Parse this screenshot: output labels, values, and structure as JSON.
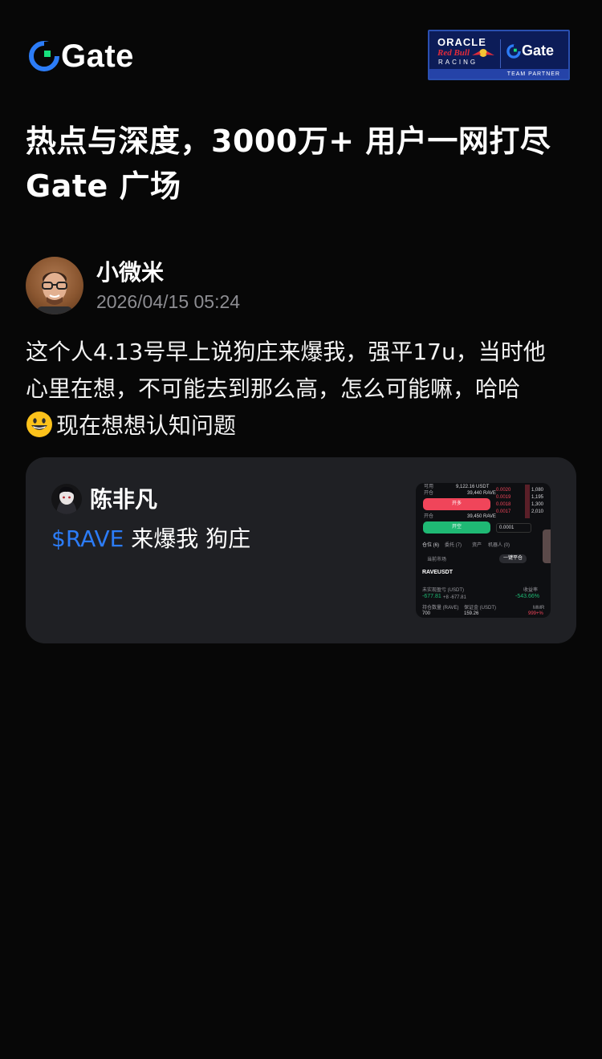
{
  "brand": {
    "name": "Gate",
    "accent": "#17e07d",
    "accent_blue": "#2c7cf7"
  },
  "partner_badge": {
    "oracle": "ORACLE",
    "redbull": "Red Bull",
    "racing": "RACING",
    "partner_brand": "Gate",
    "team_partner": "TEAM PARTNER"
  },
  "headline": {
    "line1": "热点与深度，3000万+ 用户一网打尽",
    "line2": "Gate 广场"
  },
  "post": {
    "author": "小微米",
    "timestamp": "2026/04/15 05:24",
    "body_line1": "这个人4.13号早上说狗庄来爆我，强平17u，当时他",
    "body_line2": "心里在想，不可能去到那么高，怎么可能嘛，哈哈",
    "body_line3": "现在想想认知问题",
    "emoji": "grinning-face"
  },
  "quote": {
    "author": "陈非凡",
    "ticker": "$RAVE",
    "text": " 来爆我 狗庄",
    "thumbnail": {
      "avail_label": "可用",
      "avail_value": "9,122.16 USDT",
      "open_label": "开仓",
      "open_value": "39,440 RAVE",
      "long_button": "开多",
      "open_label_2": "开仓",
      "open_value_2": "39,450 RAVE",
      "short_button": "开空",
      "order_price": "0.0001",
      "tab_positions": "仓位 (6)",
      "tab_orders": "委托 (7)",
      "tab_assets": "资产",
      "tab_bots": "机器人 (0)",
      "close_all": "一键平仓",
      "hide_other": "当前市场",
      "symbol": "RAVEUSDT",
      "pnl_label": "未实现盈亏 (USDT)",
      "pnl_value": "-677.81",
      "pnl_sub": "+8 -677.81",
      "roe_label": "收益率",
      "roe_value": "-543.66%",
      "size_label": "持仓数量 (RAVE)",
      "size_value": "700",
      "margin_label": "保证金 (USDT)",
      "margin_value": "159.26",
      "mmr_label": "MMR",
      "mmr_value": "999+%",
      "book_prices": [
        "0.0020",
        "0.0019",
        "0.0018",
        "0.0017",
        "0.0016"
      ],
      "book_sizes": [
        "1,080",
        "1,195",
        "1,300",
        "2,010"
      ]
    }
  }
}
